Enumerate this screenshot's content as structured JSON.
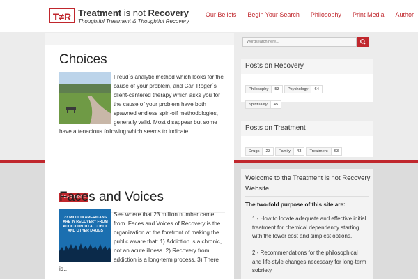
{
  "header": {
    "logo_mark": "T≠R",
    "logo_title_bold": "Treatment",
    "logo_title_mid": " is not ",
    "logo_title_end": "Recovery",
    "tagline": "Thoughtful Treatment & Thoughtful Recovery",
    "nav": [
      "Our Beliefs",
      "Begin Your Search",
      "Philosophy",
      "Print Media",
      "Author"
    ]
  },
  "posts": [
    {
      "title": "Choices",
      "excerpt": "Freud´s analytic method which looks for the cause of your problem, and Carl Roger´s client-centered therapy which asks you for the cause of your problem have both spawned endless spin-off methodologies, generally valid.  Most disappear but some have a tenacious following which seems to indicate…",
      "read_more": "READ MORE"
    },
    {
      "title": "Faces and Voices",
      "thumb_text": "23 MILLION AMERICANS ARE IN RECOVERY FROM ADDICTION TO ALCOHOL AND OTHER DRUGS",
      "excerpt": "See where that 23 million number came from. Faces and Voices of Recovery is the organization at the forefront of making the public aware that: 1) Addiction is a chronic, not an acute illness. 2) Recovery from addiction is a long-term process. 3) There is…"
    }
  ],
  "sidebar": {
    "search_placeholder": "Wordsearch here...",
    "recovery": {
      "title": "Posts on Recovery",
      "tags": [
        {
          "name": "Philosophy",
          "count": "53"
        },
        {
          "name": "Psychology",
          "count": "64"
        },
        {
          "name": "Spirituality",
          "count": "45"
        }
      ]
    },
    "treatment": {
      "title": "Posts on Treatment",
      "tags": [
        {
          "name": "Drugs",
          "count": "23"
        },
        {
          "name": "Family",
          "count": "43"
        },
        {
          "name": "Treatment",
          "count": "63"
        }
      ]
    },
    "welcome": {
      "title": "Welcome to the Treatment is not Recovery Website",
      "purpose": "The two-fold purpose of this site are:",
      "items": [
        "1 - How to locate adequate and effective initial treatment for chemical dependency starting with the lower cost and simplest options.",
        "2 - Recommendations for the philosophical and life-style changes necessary for long-term sobriety."
      ]
    }
  },
  "colors": {
    "accent": "#c0272d"
  }
}
